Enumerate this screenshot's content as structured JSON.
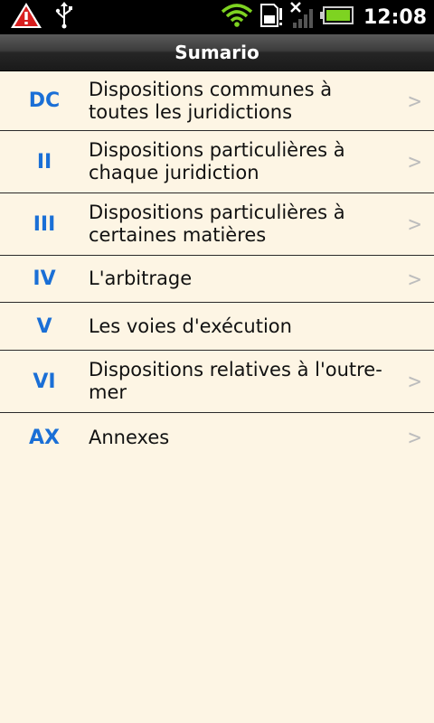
{
  "status_bar": {
    "time": "12:08",
    "icons": [
      "warning-icon",
      "usb-icon",
      "wifi-icon",
      "sd-card-icon",
      "no-signal-icon",
      "battery-icon"
    ],
    "colors": {
      "warning": "#d81e1e",
      "wifi": "#7ed321",
      "battery": "#7ed321"
    }
  },
  "header": {
    "title": "Sumario"
  },
  "list": {
    "items": [
      {
        "code": "DC",
        "label": "Dispositions communes à toutes les juridictions",
        "has_chevron": true
      },
      {
        "code": "II",
        "label": "Dispositions particulières à chaque juridiction",
        "has_chevron": true
      },
      {
        "code": "III",
        "label": "Dispositions particulières à certaines matières",
        "has_chevron": true
      },
      {
        "code": "IV",
        "label": "L'arbitrage",
        "has_chevron": true
      },
      {
        "code": "V",
        "label": "Les voies d'exécution",
        "has_chevron": false
      },
      {
        "code": "VI",
        "label": "Dispositions relatives à l'outre-mer",
        "has_chevron": true
      },
      {
        "code": "AX",
        "label": "Annexes",
        "has_chevron": true
      }
    ],
    "chevron_glyph": ">",
    "code_color": "#1a6fd6"
  }
}
